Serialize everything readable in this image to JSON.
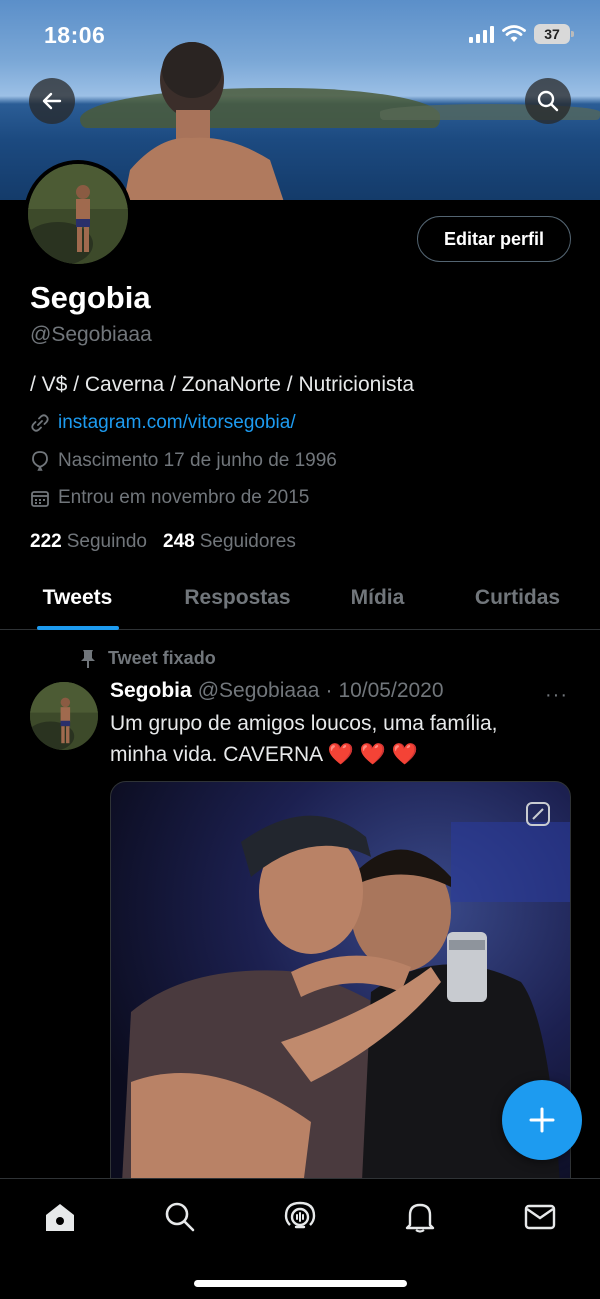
{
  "status_bar": {
    "time": "18:06",
    "battery": "37"
  },
  "profile": {
    "name": "Segobia",
    "handle": "@Segobiaaa",
    "bio": "/ V$ / Caverna / ZonaNorte / Nutricionista",
    "link": "instagram.com/vitorsegobia/",
    "birth": "Nascimento 17 de junho de 1996",
    "joined": "Entrou em novembro de 2015",
    "following_count": "222",
    "following_label": "Seguindo",
    "followers_count": "248",
    "followers_label": "Seguidores",
    "edit_label": "Editar perfil"
  },
  "tabs": [
    {
      "label": "Tweets",
      "active": true
    },
    {
      "label": "Respostas",
      "active": false
    },
    {
      "label": "Mídia",
      "active": false
    },
    {
      "label": "Curtidas",
      "active": false
    }
  ],
  "tweet": {
    "pinned_label": "Tweet fixado",
    "author": "Segobia",
    "handle": "@Segobiaaa",
    "separator": "·",
    "date": "10/05/2020",
    "more": "···",
    "text": "Um grupo de amigos loucos, uma família, minha vida. CAVERNA",
    "hearts": "❤️ ❤️ ❤️"
  },
  "icons": {
    "back": "back-arrow-icon",
    "search": "search-icon",
    "compose": "plus-icon",
    "nav": [
      "home-icon",
      "search-icon",
      "spaces-icon",
      "notifications-icon",
      "messages-icon"
    ]
  },
  "colors": {
    "accent": "#1d9bf0",
    "background": "#000000",
    "secondary_text": "#71767b"
  }
}
